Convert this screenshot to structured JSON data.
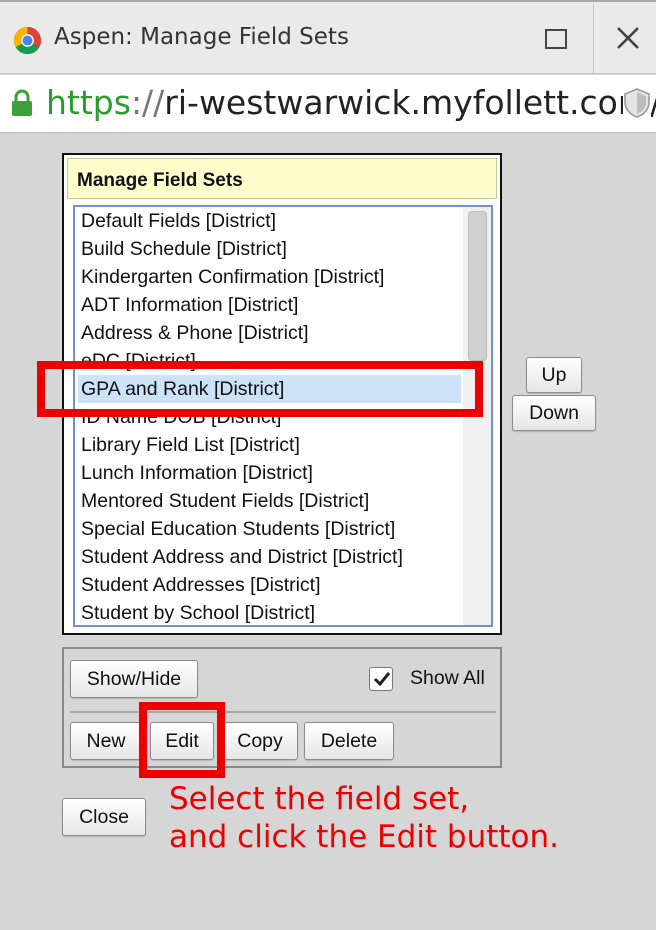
{
  "window": {
    "title": "Aspen: Manage Field Sets"
  },
  "address_bar": {
    "scheme": "https",
    "separator": "://",
    "host": "ri-westwarwick.myfollett.com/"
  },
  "panel": {
    "title": "Manage Field Sets",
    "items": [
      "Default Fields [District]",
      "Build Schedule [District]",
      "Kindergarten Confirmation [District]",
      "ADT Information [District]",
      "Address & Phone [District]",
      "eDC [District]",
      "GPA and Rank [District]",
      "ID Name DOB [District]",
      "Library Field List [District]",
      "Lunch Information [District]",
      "Mentored Student Fields [District]",
      "Special Education Students [District]",
      "Student Address and District [District]",
      "Student Addresses [District]",
      "Student by School [District]"
    ],
    "selected_item": "GPA and Rank [District]"
  },
  "order_buttons": {
    "up": "Up",
    "down": "Down"
  },
  "actions": {
    "show_hide": "Show/Hide",
    "show_all_label": "Show All",
    "show_all_checked": true,
    "new": "New",
    "edit": "Edit",
    "copy": "Copy",
    "delete": "Delete"
  },
  "close_button": "Close",
  "annotation": {
    "line1": "Select the field set,",
    "line2": "and click the Edit button.",
    "color": "#ee0000"
  },
  "colors": {
    "header_bg": "#ffffcc",
    "selection_bg": "#cce3f7",
    "listbox_border": "#6f8fd8",
    "url_scheme": "#2a9d2a"
  }
}
